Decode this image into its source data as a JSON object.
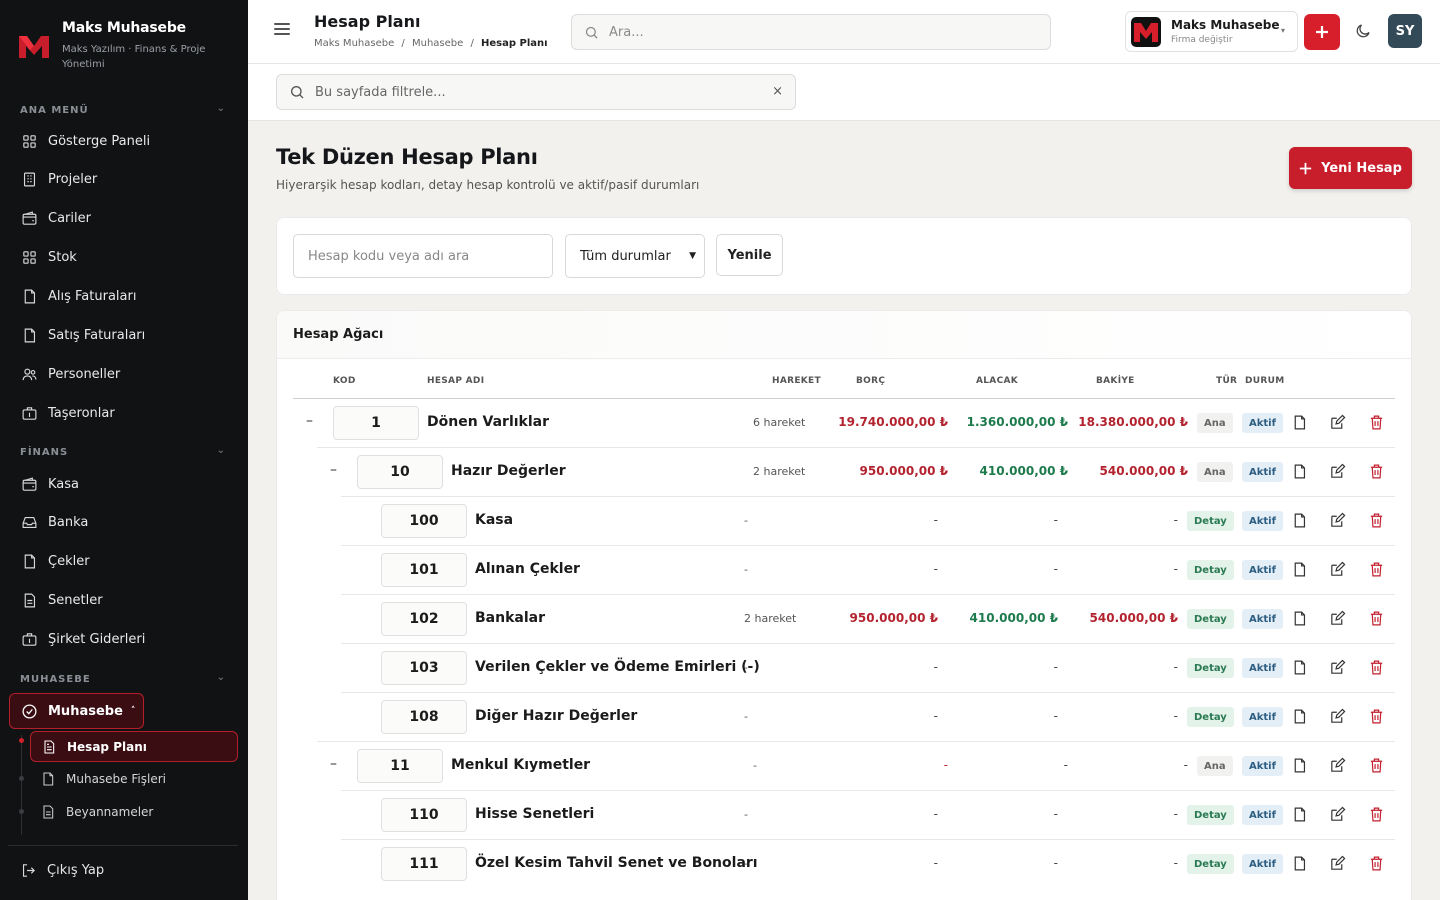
{
  "brand": {
    "title": "Maks Muhasebe",
    "subtitle": "Maks Yazılım · Finans & Proje Yönetimi"
  },
  "sidebar": {
    "sections": [
      {
        "label": "ANA MENÜ",
        "items": [
          {
            "label": "Gösterge Paneli",
            "icon": "grid-icon"
          },
          {
            "label": "Projeler",
            "icon": "building-icon"
          },
          {
            "label": "Cariler",
            "icon": "wallet-icon"
          },
          {
            "label": "Stok",
            "icon": "grid-icon"
          },
          {
            "label": "Alış Faturaları",
            "icon": "file-icon"
          },
          {
            "label": "Satış Faturaları",
            "icon": "file-icon"
          },
          {
            "label": "Personeller",
            "icon": "users-icon"
          },
          {
            "label": "Taşeronlar",
            "icon": "briefcase-icon"
          }
        ]
      },
      {
        "label": "FİNANS",
        "items": [
          {
            "label": "Kasa",
            "icon": "wallet-icon"
          },
          {
            "label": "Banka",
            "icon": "inbox-icon"
          },
          {
            "label": "Çekler",
            "icon": "file-icon"
          },
          {
            "label": "Senetler",
            "icon": "file-text-icon"
          },
          {
            "label": "Şirket Giderleri",
            "icon": "briefcase-icon"
          }
        ]
      },
      {
        "label": "MUHASEBE",
        "items": []
      }
    ],
    "active_group": "Muhasebe",
    "sub_items": [
      "Hesap Planı",
      "Muhasebe Fişleri",
      "Beyannameler"
    ],
    "logout": "Çıkış Yap"
  },
  "header": {
    "title": "Hesap Planı",
    "breadcrumb": [
      "Maks Muhasebe",
      "Muhasebe",
      "Hesap Planı"
    ],
    "breadcrumb_sep": "/",
    "search_placeholder": "Ara...",
    "firm_name": "Maks Muhasebe",
    "firm_sub": "Firma değiştir",
    "avatar": "SY"
  },
  "page_filter": {
    "placeholder": "Bu sayfada filtrele...",
    "clear": "×"
  },
  "page": {
    "title": "Tek Düzen Hesap Planı",
    "subtitle": "Hiyerarşik hesap kodları, detay hesap kontrolü ve aktif/pasif durumları",
    "new_button": "Yeni Hesap"
  },
  "toolbar": {
    "search_placeholder": "Hesap kodu veya adı ara",
    "status_select": "Tüm durumlar",
    "refresh": "Yenile"
  },
  "tree": {
    "title": "Hesap Ağacı",
    "columns": [
      "KOD",
      "HESAP ADI",
      "HAREKET",
      "BORÇ",
      "ALACAK",
      "BAKİYE",
      "TÜR",
      "DURUM"
    ],
    "rows": [
      {
        "level": 0,
        "toggle": "–",
        "code": "1",
        "name": "Dönen Varlıklar",
        "hareket": "6 hareket",
        "borc": "19.740.000,00 ₺",
        "alacak": "1.360.000,00 ₺",
        "bakiye": "18.380.000,00 ₺",
        "tur": "Ana",
        "durum": "Aktif"
      },
      {
        "level": 1,
        "toggle": "–",
        "code": "10",
        "name": "Hazır Değerler",
        "hareket": "2 hareket",
        "borc": "950.000,00 ₺",
        "alacak": "410.000,00 ₺",
        "bakiye": "540.000,00 ₺",
        "tur": "Ana",
        "durum": "Aktif"
      },
      {
        "level": 2,
        "toggle": "",
        "code": "100",
        "name": "Kasa",
        "hareket": "-",
        "borc": "-",
        "alacak": "-",
        "bakiye": "-",
        "tur": "Detay",
        "durum": "Aktif"
      },
      {
        "level": 2,
        "toggle": "",
        "code": "101",
        "name": "Alınan Çekler",
        "hareket": "-",
        "borc": "-",
        "alacak": "-",
        "bakiye": "-",
        "tur": "Detay",
        "durum": "Aktif"
      },
      {
        "level": 2,
        "toggle": "",
        "code": "102",
        "name": "Bankalar",
        "hareket": "2 hareket",
        "borc": "950.000,00 ₺",
        "alacak": "410.000,00 ₺",
        "bakiye": "540.000,00 ₺",
        "tur": "Detay",
        "durum": "Aktif"
      },
      {
        "level": 2,
        "toggle": "",
        "code": "103",
        "name": "Verilen Çekler ve Ödeme Emirleri (-)",
        "hareket": "-",
        "borc": "-",
        "alacak": "-",
        "bakiye": "-",
        "tur": "Detay",
        "durum": "Aktif"
      },
      {
        "level": 2,
        "toggle": "",
        "code": "108",
        "name": "Diğer Hazır Değerler",
        "hareket": "-",
        "borc": "-",
        "alacak": "-",
        "bakiye": "-",
        "tur": "Detay",
        "durum": "Aktif"
      },
      {
        "level": 1,
        "toggle": "–",
        "code": "11",
        "name": "Menkul Kıymetler",
        "hareket": "-",
        "borc": "-",
        "alacak": "-",
        "bakiye": "-",
        "tur": "Ana",
        "durum": "Aktif"
      },
      {
        "level": 2,
        "toggle": "",
        "code": "110",
        "name": "Hisse Senetleri",
        "hareket": "-",
        "borc": "-",
        "alacak": "-",
        "bakiye": "-",
        "tur": "Detay",
        "durum": "Aktif"
      },
      {
        "level": 2,
        "toggle": "",
        "code": "111",
        "name": "Özel Kesim Tahvil Senet ve Bonoları",
        "hareket": "-",
        "borc": "-",
        "alacak": "-",
        "bakiye": "-",
        "tur": "Detay",
        "durum": "Aktif"
      }
    ]
  },
  "colors": {
    "accent": "#d71f2b",
    "sidebar_bg": "#111214",
    "debit": "#b3232f",
    "credit": "#1d7a4c"
  }
}
